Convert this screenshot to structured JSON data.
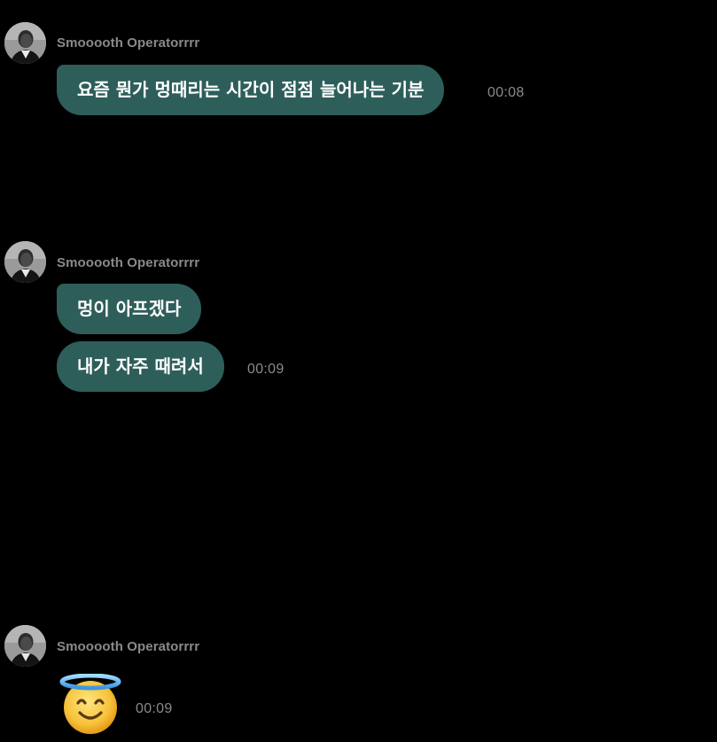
{
  "messages": [
    {
      "sender": "Smooooth Operatorrrr",
      "bubbles": [
        "요즘 뭔가 멍때리는 시간이 점점 늘어나는 기분"
      ],
      "time": "00:08"
    },
    {
      "sender": "Smooooth Operatorrrr",
      "bubbles": [
        "멍이 아프겠다",
        "내가 자주 때려서"
      ],
      "time": "00:09"
    },
    {
      "sender": "Smooooth Operatorrrr",
      "emoji": "smiling-face-with-halo-icon",
      "time": "00:09"
    }
  ],
  "colors": {
    "background": "#000000",
    "bubble": "#2e5e5a",
    "muted_text": "#8a8a8a",
    "bubble_text": "#ffffff"
  }
}
